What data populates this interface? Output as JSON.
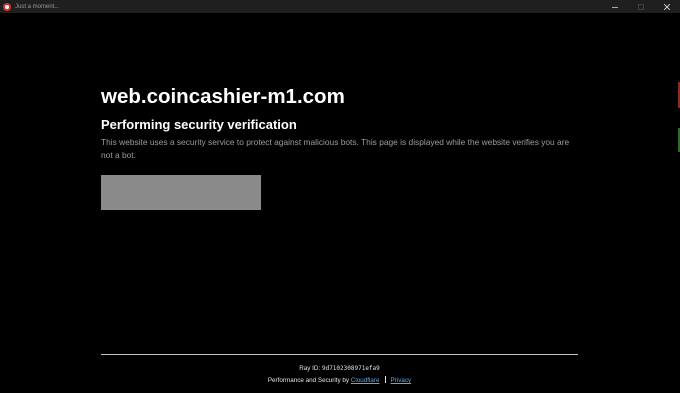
{
  "window": {
    "title": "Just a moment...",
    "icon": "browser-app-icon",
    "controls": [
      "minimize-icon",
      "maximize-icon",
      "close-icon"
    ]
  },
  "main": {
    "domain": "web.coincashier-m1.com",
    "heading": "Performing security verification",
    "description": "This website uses a security service to protect against malicious bots. This page is displayed while the website verifies you are not a bot."
  },
  "footer": {
    "ray_label": "Ray ID: ",
    "ray_id": "9d7102308971efa9",
    "performance_prefix": "Performance and Security by ",
    "cloudflare_link": "Cloudflare",
    "privacy_link": "Privacy"
  },
  "colors": {
    "background": "#000000",
    "titlebar": "#1f1f1f",
    "widget_placeholder": "#8a8a8a",
    "link": "#5da9e9",
    "description_text": "#9d9d9d"
  }
}
